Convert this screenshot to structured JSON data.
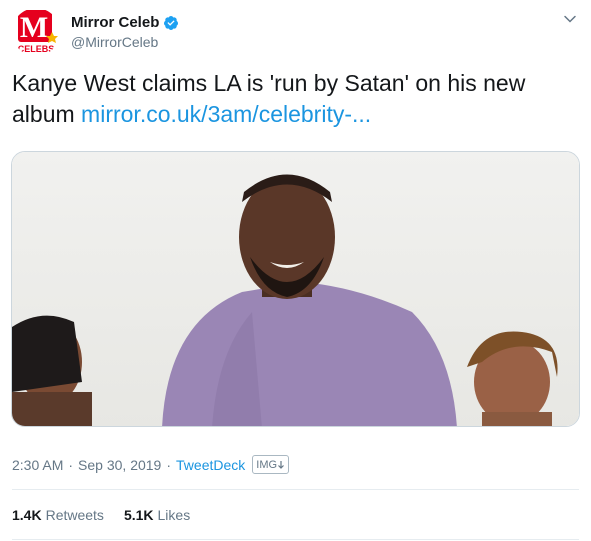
{
  "account": {
    "display_name": "Mirror Celeb",
    "handle": "@MirrorCeleb",
    "avatar_letter": "M",
    "avatar_text": "CELEBS",
    "verified_icon": "verified-badge-icon"
  },
  "tweet": {
    "text": "Kanye West claims LA is 'run by Satan' on his new album ",
    "link": "mirror.co.uk/3am/celebrity-..."
  },
  "media": {
    "description": "photo"
  },
  "meta": {
    "time": "2:30 AM",
    "separator": "·",
    "date": "Sep 30, 2019",
    "source": "TweetDeck",
    "img_badge": "IMG"
  },
  "stats": {
    "retweets_count": "1.4K",
    "retweets_label": "Retweets",
    "likes_count": "5.1K",
    "likes_label": "Likes"
  },
  "colors": {
    "link": "#1b95e0",
    "brand_red": "#e5001e",
    "secondary_text": "#657786"
  }
}
